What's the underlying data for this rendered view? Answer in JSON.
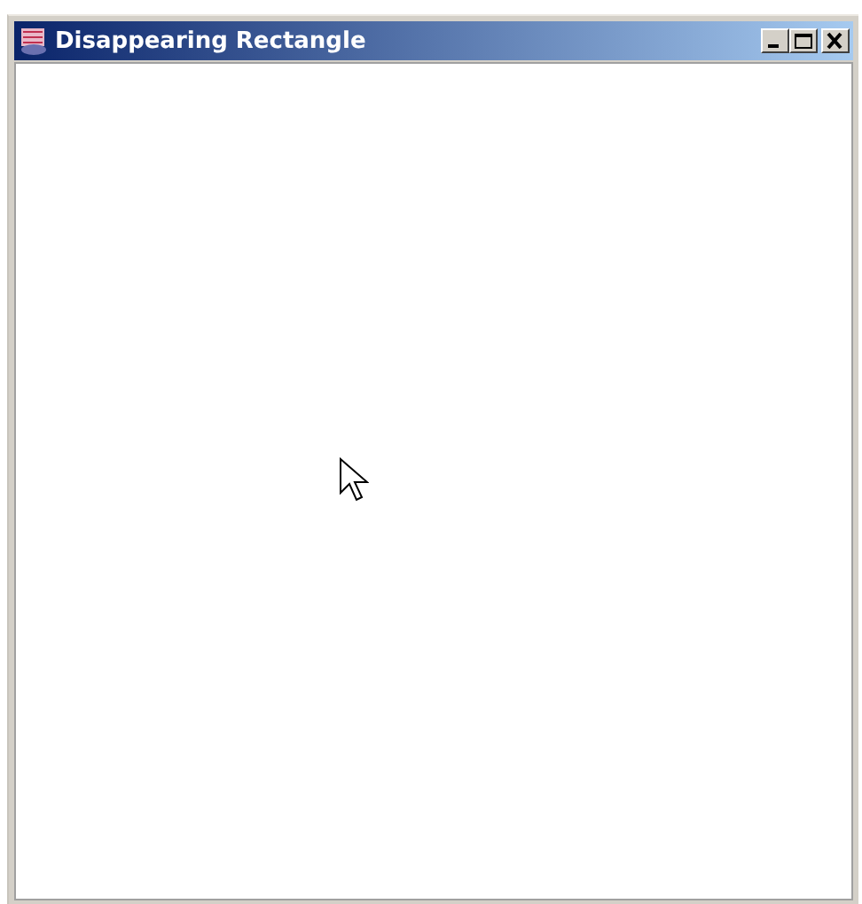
{
  "window": {
    "title": "Disappearing Rectangle"
  }
}
